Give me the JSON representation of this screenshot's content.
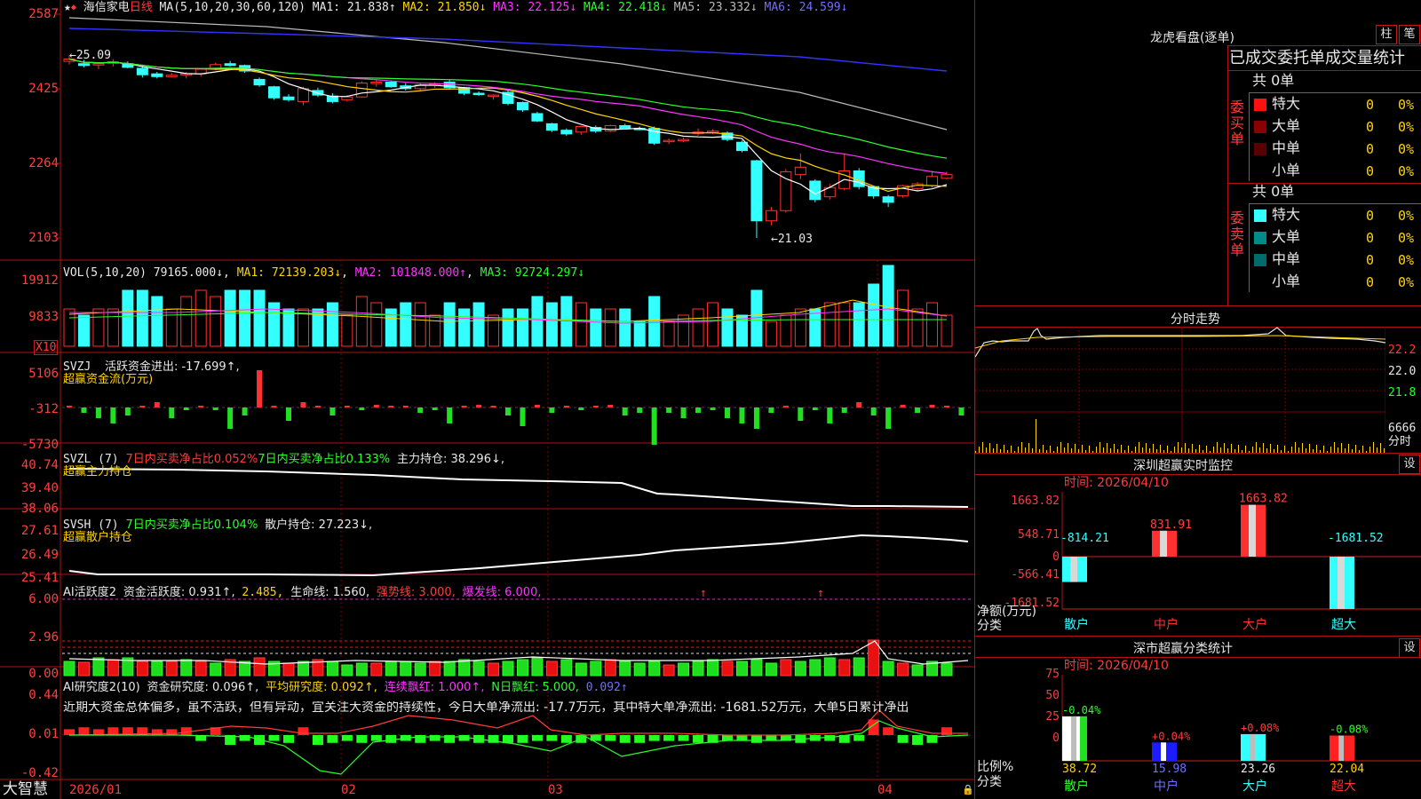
{
  "header": {
    "stock_name": "海信家电",
    "period": "日线",
    "ma_caption": "MA(5,10,20,30,60,120)",
    "ma1": "MA1: 21.838↑",
    "ma2": "MA2: 21.850↓",
    "ma3": "MA3: 22.125↓",
    "ma4": "MA4: 22.418↓",
    "ma5": "MA5: 23.332↓",
    "ma6": "MA6: 24.599↓"
  },
  "price_axis": [
    "2587",
    "2425",
    "2264",
    "2103"
  ],
  "price_labels": {
    "high": "←25.09",
    "low": "←21.03"
  },
  "vol": {
    "caption": "VOL(5,10,20)",
    "value": "79165.000↓",
    "ma1": "MA1: 72139.203↓",
    "ma2": "MA2: 101848.000↑",
    "ma3": "MA3: 92724.297↓",
    "axis": [
      "19912",
      "9833"
    ],
    "x10": "X10"
  },
  "svzj": {
    "caption": "SVZJ",
    "label": "活跃资金进出: -17.699↑,",
    "sub": "超赢资金流(万元)",
    "axis": [
      "5106",
      "-312",
      "-5730"
    ]
  },
  "svzl": {
    "caption": "SVZL (7)",
    "a": "7日内买卖净占比0.052%",
    "b": "7日内买卖净占比0.133%",
    "c": "主力持仓: 38.296↓,",
    "sub": "超赢主力持仓",
    "axis": [
      "40.74",
      "39.40",
      "38.06"
    ]
  },
  "svsh": {
    "caption": "SVSH (7)",
    "a": "7日内买卖净占比0.104%",
    "b": "散户持仓: 27.223↓,",
    "sub": "超赢散户持仓",
    "axis": [
      "27.61",
      "26.49",
      "25.41"
    ]
  },
  "ai1": {
    "caption": "AI活跃度2",
    "a": "资金活跃度: 0.931↑,",
    "b": "2.485,",
    "c": "生命线: 1.560,",
    "d": "强势线: 3.000,",
    "e": "爆发线: 6.000,",
    "axis": [
      "6.00",
      "2.96",
      "0.00"
    ]
  },
  "ai2": {
    "caption": "AI研究度2(10)",
    "a": "资金研究度: 0.096↑,",
    "b": "平均研究度: 0.092↑,",
    "c": "连续飘红: 1.000↑,",
    "d": "N日飘红: 5.000,",
    "e": "0.092↑",
    "desc": "近期大资金总体偏多，虽不活跃，但有异动，宜关注大资金的持续性，今日大单净流出: -17.7万元，其中特大单净流出: -1681.52万元，大单5日累计净出",
    "axis": [
      "0.44",
      "0.01",
      "-0.42"
    ]
  },
  "footer": {
    "brand": "大智慧",
    "dates": [
      "2026/01",
      "02",
      "03",
      "04"
    ]
  },
  "right": {
    "dragon_title": "龙虎看盘(逐单)",
    "btn_zhu": "柱",
    "btn_bi": "笔",
    "stat_title": "已成交委托单成交量统计",
    "buy_label": "委买单",
    "sell_label": "委卖单",
    "buy_total": "共 0单",
    "sell_total": "共 0单",
    "buy_rows": [
      {
        "name": "特大",
        "count": "0",
        "pct": "0%",
        "color": "#ff1010"
      },
      {
        "name": "大单",
        "count": "0",
        "pct": "0%",
        "color": "#8b0000"
      },
      {
        "name": "中单",
        "count": "0",
        "pct": "0%",
        "color": "#5a0000"
      },
      {
        "name": "小单",
        "count": "0",
        "pct": "0%",
        "color": ""
      }
    ],
    "sell_rows": [
      {
        "name": "特大",
        "count": "0",
        "pct": "0%",
        "color": "#33ffff"
      },
      {
        "name": "大单",
        "count": "0",
        "pct": "0%",
        "color": "#008b8b"
      },
      {
        "name": "中单",
        "count": "0",
        "pct": "0%",
        "color": "#006b6b"
      },
      {
        "name": "小单",
        "count": "0",
        "pct": "0%",
        "color": ""
      }
    ],
    "intraday_title": "分时走势",
    "intraday_axis": [
      "22.2",
      "22.0",
      "21.8"
    ],
    "intraday_vol": "6666",
    "intraday_vol_unit": "分时",
    "sz_title": "深圳超赢实时监控",
    "sz_btn": "设",
    "sz_time": "时间: 2026/04/10",
    "sz_axis": [
      "1663.82",
      "548.71",
      "0",
      "-566.41",
      "-1681.52"
    ],
    "sz_ylabel1": "净额(万元)",
    "sz_ylabel2": "分类",
    "sz_bars": [
      {
        "cat": "散户",
        "value": "-814.21"
      },
      {
        "cat": "中户",
        "value": "831.91"
      },
      {
        "cat": "大户",
        "value": "1663.82"
      },
      {
        "cat": "超大",
        "value": "-1681.52"
      }
    ],
    "sc_title": "深市超赢分类统计",
    "sc_btn": "设",
    "sc_time": "时间: 2026/04/10",
    "sc_axis": [
      "75",
      "50",
      "25",
      "0"
    ],
    "sc_ylabel1": "比例%",
    "sc_ylabel2": "分类",
    "sc_bars": [
      {
        "cat": "散户",
        "chg": "-0.04%",
        "pct": "38.72",
        "color": "#ffffff"
      },
      {
        "cat": "中户",
        "chg": "+0.04%",
        "pct": "15.98",
        "color": "#1c1cff"
      },
      {
        "cat": "大户",
        "chg": "+0.08%",
        "pct": "23.26",
        "color": "#33ffff"
      },
      {
        "cat": "超大",
        "chg": "-0.08%",
        "pct": "22.04",
        "color": "#ff2020"
      }
    ]
  },
  "chart_data": {
    "type": "candlestick",
    "candles_ohlc": [
      [
        24.85,
        24.98,
        24.78,
        24.9
      ],
      [
        24.8,
        24.88,
        24.72,
        24.76
      ],
      [
        24.78,
        24.82,
        24.68,
        24.8
      ],
      [
        24.82,
        24.9,
        24.74,
        24.84
      ],
      [
        24.8,
        24.85,
        24.7,
        24.72
      ],
      [
        24.7,
        24.78,
        24.5,
        24.56
      ],
      [
        24.58,
        24.62,
        24.48,
        24.52
      ],
      [
        24.52,
        24.6,
        24.5,
        24.55
      ],
      [
        24.55,
        24.62,
        24.48,
        24.58
      ],
      [
        24.58,
        24.7,
        24.52,
        24.68
      ],
      [
        24.7,
        24.82,
        24.66,
        24.78
      ],
      [
        24.8,
        24.86,
        24.74,
        24.76
      ],
      [
        24.76,
        24.78,
        24.6,
        24.64
      ],
      [
        24.46,
        24.5,
        24.3,
        24.34
      ],
      [
        24.3,
        24.32,
        24.02,
        24.06
      ],
      [
        24.08,
        24.14,
        23.98,
        24.02
      ],
      [
        23.98,
        24.3,
        23.9,
        24.26
      ],
      [
        24.22,
        24.28,
        24.08,
        24.12
      ],
      [
        24.1,
        24.16,
        23.94,
        23.98
      ],
      [
        24.02,
        24.12,
        23.98,
        24.08
      ],
      [
        24.08,
        24.42,
        24.06,
        24.38
      ],
      [
        24.38,
        24.46,
        24.3,
        24.4
      ],
      [
        24.4,
        24.44,
        24.28,
        24.3
      ],
      [
        24.32,
        24.38,
        24.22,
        24.26
      ],
      [
        24.26,
        24.38,
        24.22,
        24.34
      ],
      [
        24.34,
        24.4,
        24.28,
        24.36
      ],
      [
        24.4,
        24.46,
        24.24,
        24.28
      ],
      [
        24.28,
        24.3,
        24.12,
        24.16
      ],
      [
        24.16,
        24.2,
        24.1,
        24.14
      ],
      [
        24.12,
        24.14,
        24.02,
        24.12
      ],
      [
        24.18,
        24.24,
        23.9,
        23.94
      ],
      [
        23.96,
        23.98,
        23.76,
        23.8
      ],
      [
        23.72,
        23.76,
        23.54,
        23.56
      ],
      [
        23.5,
        23.52,
        23.32,
        23.36
      ],
      [
        23.36,
        23.4,
        23.24,
        23.28
      ],
      [
        23.32,
        23.46,
        23.26,
        23.44
      ],
      [
        23.42,
        23.46,
        23.3,
        23.34
      ],
      [
        23.34,
        23.48,
        23.32,
        23.46
      ],
      [
        23.46,
        23.5,
        23.38,
        23.4
      ],
      [
        23.4,
        23.44,
        23.36,
        23.38
      ],
      [
        23.4,
        23.44,
        23.04,
        23.08
      ],
      [
        23.12,
        23.18,
        23.06,
        23.14
      ],
      [
        23.14,
        23.2,
        23.1,
        23.16
      ],
      [
        23.3,
        23.4,
        23.24,
        23.32
      ],
      [
        23.32,
        23.38,
        23.28,
        23.34
      ],
      [
        23.3,
        23.34,
        23.12,
        23.16
      ],
      [
        23.1,
        23.14,
        22.88,
        22.92
      ],
      [
        22.7,
        22.72,
        21.03,
        21.4
      ],
      [
        21.4,
        21.7,
        21.3,
        21.62
      ],
      [
        21.62,
        22.52,
        21.58,
        22.46
      ],
      [
        22.4,
        22.86,
        22.3,
        22.56
      ],
      [
        22.26,
        22.3,
        21.8,
        21.86
      ],
      [
        21.92,
        22.2,
        21.86,
        22.12
      ],
      [
        22.1,
        22.86,
        22.06,
        22.48
      ],
      [
        22.48,
        22.54,
        22.08,
        22.14
      ],
      [
        22.14,
        22.16,
        21.88,
        21.94
      ],
      [
        21.92,
        21.96,
        21.7,
        21.8
      ],
      [
        21.94,
        22.18,
        21.9,
        22.16
      ],
      [
        22.1,
        22.24,
        22.06,
        22.2
      ],
      [
        22.16,
        22.48,
        22.12,
        22.36
      ],
      [
        22.32,
        22.46,
        22.3,
        22.4
      ]
    ],
    "ma_names": [
      "MA1",
      "MA2",
      "MA3",
      "MA4",
      "MA5",
      "MA6"
    ],
    "volume_sample": [
      6,
      5,
      6,
      6,
      9,
      9,
      8,
      6,
      8,
      9,
      8,
      9,
      9,
      9,
      7,
      6,
      6,
      6,
      7,
      5,
      8,
      7,
      6,
      7,
      7,
      5,
      7,
      6,
      7,
      5,
      6,
      6,
      8,
      7,
      8,
      7,
      6,
      6,
      6,
      4,
      8,
      4,
      5,
      6,
      7,
      6,
      5,
      9,
      4,
      5,
      6,
      6,
      7,
      7,
      7,
      10,
      13,
      9,
      6,
      7,
      5
    ]
  }
}
